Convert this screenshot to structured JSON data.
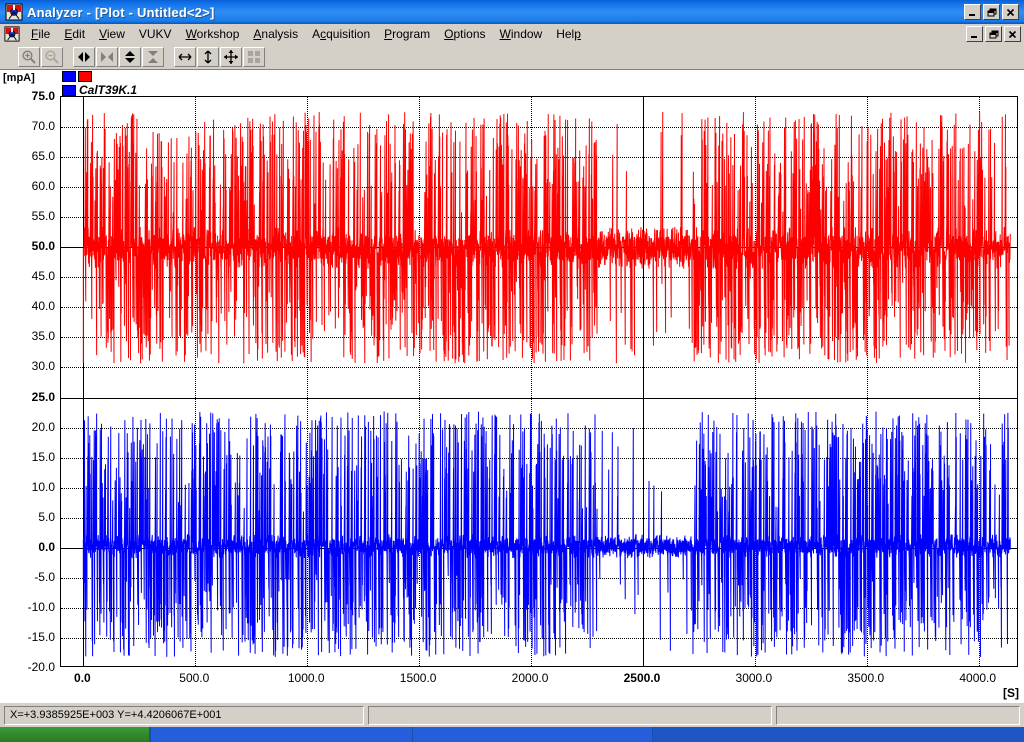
{
  "window": {
    "title": "Analyzer - [Plot - Untitled<2>]",
    "app_icon": "analyzer-app-icon",
    "buttons": {
      "minimize": "_",
      "restore": "❐",
      "close": "✕"
    }
  },
  "menu": {
    "icon": "document-icon",
    "items": [
      {
        "label": "File",
        "accel": "F"
      },
      {
        "label": "Edit",
        "accel": "E"
      },
      {
        "label": "View",
        "accel": "V"
      },
      {
        "label": "VUKV",
        "accel": ""
      },
      {
        "label": "Workshop",
        "accel": "W"
      },
      {
        "label": "Analysis",
        "accel": "A"
      },
      {
        "label": "Acquisition",
        "accel": "c"
      },
      {
        "label": "Program",
        "accel": "P"
      },
      {
        "label": "Options",
        "accel": "O"
      },
      {
        "label": "Window",
        "accel": "W"
      },
      {
        "label": "Help",
        "accel": "H"
      }
    ],
    "mdi_buttons": {
      "minimize": "_",
      "restore": "❐",
      "close": "✕"
    }
  },
  "toolbar": {
    "buttons": [
      {
        "name": "zoom-in-icon",
        "label": "Zoom In",
        "enabled": true
      },
      {
        "name": "zoom-out-icon",
        "label": "Zoom Out",
        "enabled": false
      },
      {
        "name": "expand-horizontal-icon",
        "label": "Expand X",
        "enabled": true
      },
      {
        "name": "collapse-horizontal-icon",
        "label": "Collapse X",
        "enabled": false
      },
      {
        "name": "expand-vertical-icon",
        "label": "Expand Y",
        "enabled": true
      },
      {
        "name": "collapse-vertical-icon",
        "label": "Collapse Y",
        "enabled": false
      },
      {
        "name": "pan-horizontal-icon",
        "label": "Pan X",
        "enabled": true
      },
      {
        "name": "pan-vertical-icon",
        "label": "Pan Y",
        "enabled": true
      },
      {
        "name": "pan-all-icon",
        "label": "Pan",
        "enabled": true
      },
      {
        "name": "fit-all-icon",
        "label": "Fit All",
        "enabled": false
      }
    ]
  },
  "plot": {
    "y_unit": "[mpA]",
    "x_unit": "[S]",
    "legend": {
      "swatch_blue": "#0000ff",
      "swatch_red": "#ff0000",
      "channel_label": "CalT39K.1"
    }
  },
  "chart_data": {
    "type": "line",
    "title": "",
    "xlabel": "[S]",
    "ylabel": "[mpA]",
    "xlim": [
      -100,
      4180
    ],
    "ylim": [
      -20.0,
      75.0
    ],
    "grid": true,
    "legend_position": "top-left",
    "x_ticks": [
      0.0,
      500.0,
      1000.0,
      1500.0,
      2000.0,
      2500.0,
      3000.0,
      3500.0,
      4000.0
    ],
    "x_tick_labels": [
      "0.0",
      "500.0",
      "1000.0",
      "1500.0",
      "2000.0",
      "2500.0",
      "3000.0",
      "3500.0",
      "4000.0"
    ],
    "x_major_ticks": [
      0.0,
      2500.0
    ],
    "y_ticks": [
      75.0,
      70.0,
      65.0,
      60.0,
      55.0,
      50.0,
      45.0,
      40.0,
      35.0,
      30.0,
      25.0,
      20.0,
      15.0,
      10.0,
      5.0,
      0.0,
      -5.0,
      -10.0,
      -15.0,
      -20.0
    ],
    "y_tick_labels": [
      "75.0",
      "70.0",
      "65.0",
      "60.0",
      "55.0",
      "50.0",
      "45.0",
      "40.0",
      "35.0",
      "30.0",
      "25.0",
      "20.0",
      "15.0",
      "10.0",
      "5.0",
      "0.0",
      "-5.0",
      "-10.0",
      "-15.0",
      "-20.0"
    ],
    "y_major_ticks": [
      75.0,
      50.0,
      25.0,
      0.0
    ],
    "series": [
      {
        "name": "CalT39K.1 (red)",
        "color": "#ff0000",
        "baseline": 49.8,
        "noise_band": [
          46.0,
          53.0
        ],
        "spike_range": [
          30.5,
          72.5
        ],
        "x_range": [
          0,
          4150
        ],
        "sample_count": 4150,
        "description": "Dense noisy spiking signal centred on 50 mpA, spikes between 30.5 and 72.5"
      },
      {
        "name": "CalT39K.1 (blue)",
        "color": "#0000ff",
        "baseline": 0.0,
        "noise_band": [
          -2.0,
          2.0
        ],
        "spike_range": [
          -18.5,
          22.5
        ],
        "x_range": [
          0,
          4150
        ],
        "sample_count": 4150,
        "description": "Dense noisy spiking signal centred on 0 mpA, spikes between -18.5 and 22.5"
      }
    ]
  },
  "status": {
    "coordinates": "X=+3.9385925E+003  Y=+4.4206067E+001",
    "pane2": "",
    "pane3": ""
  }
}
